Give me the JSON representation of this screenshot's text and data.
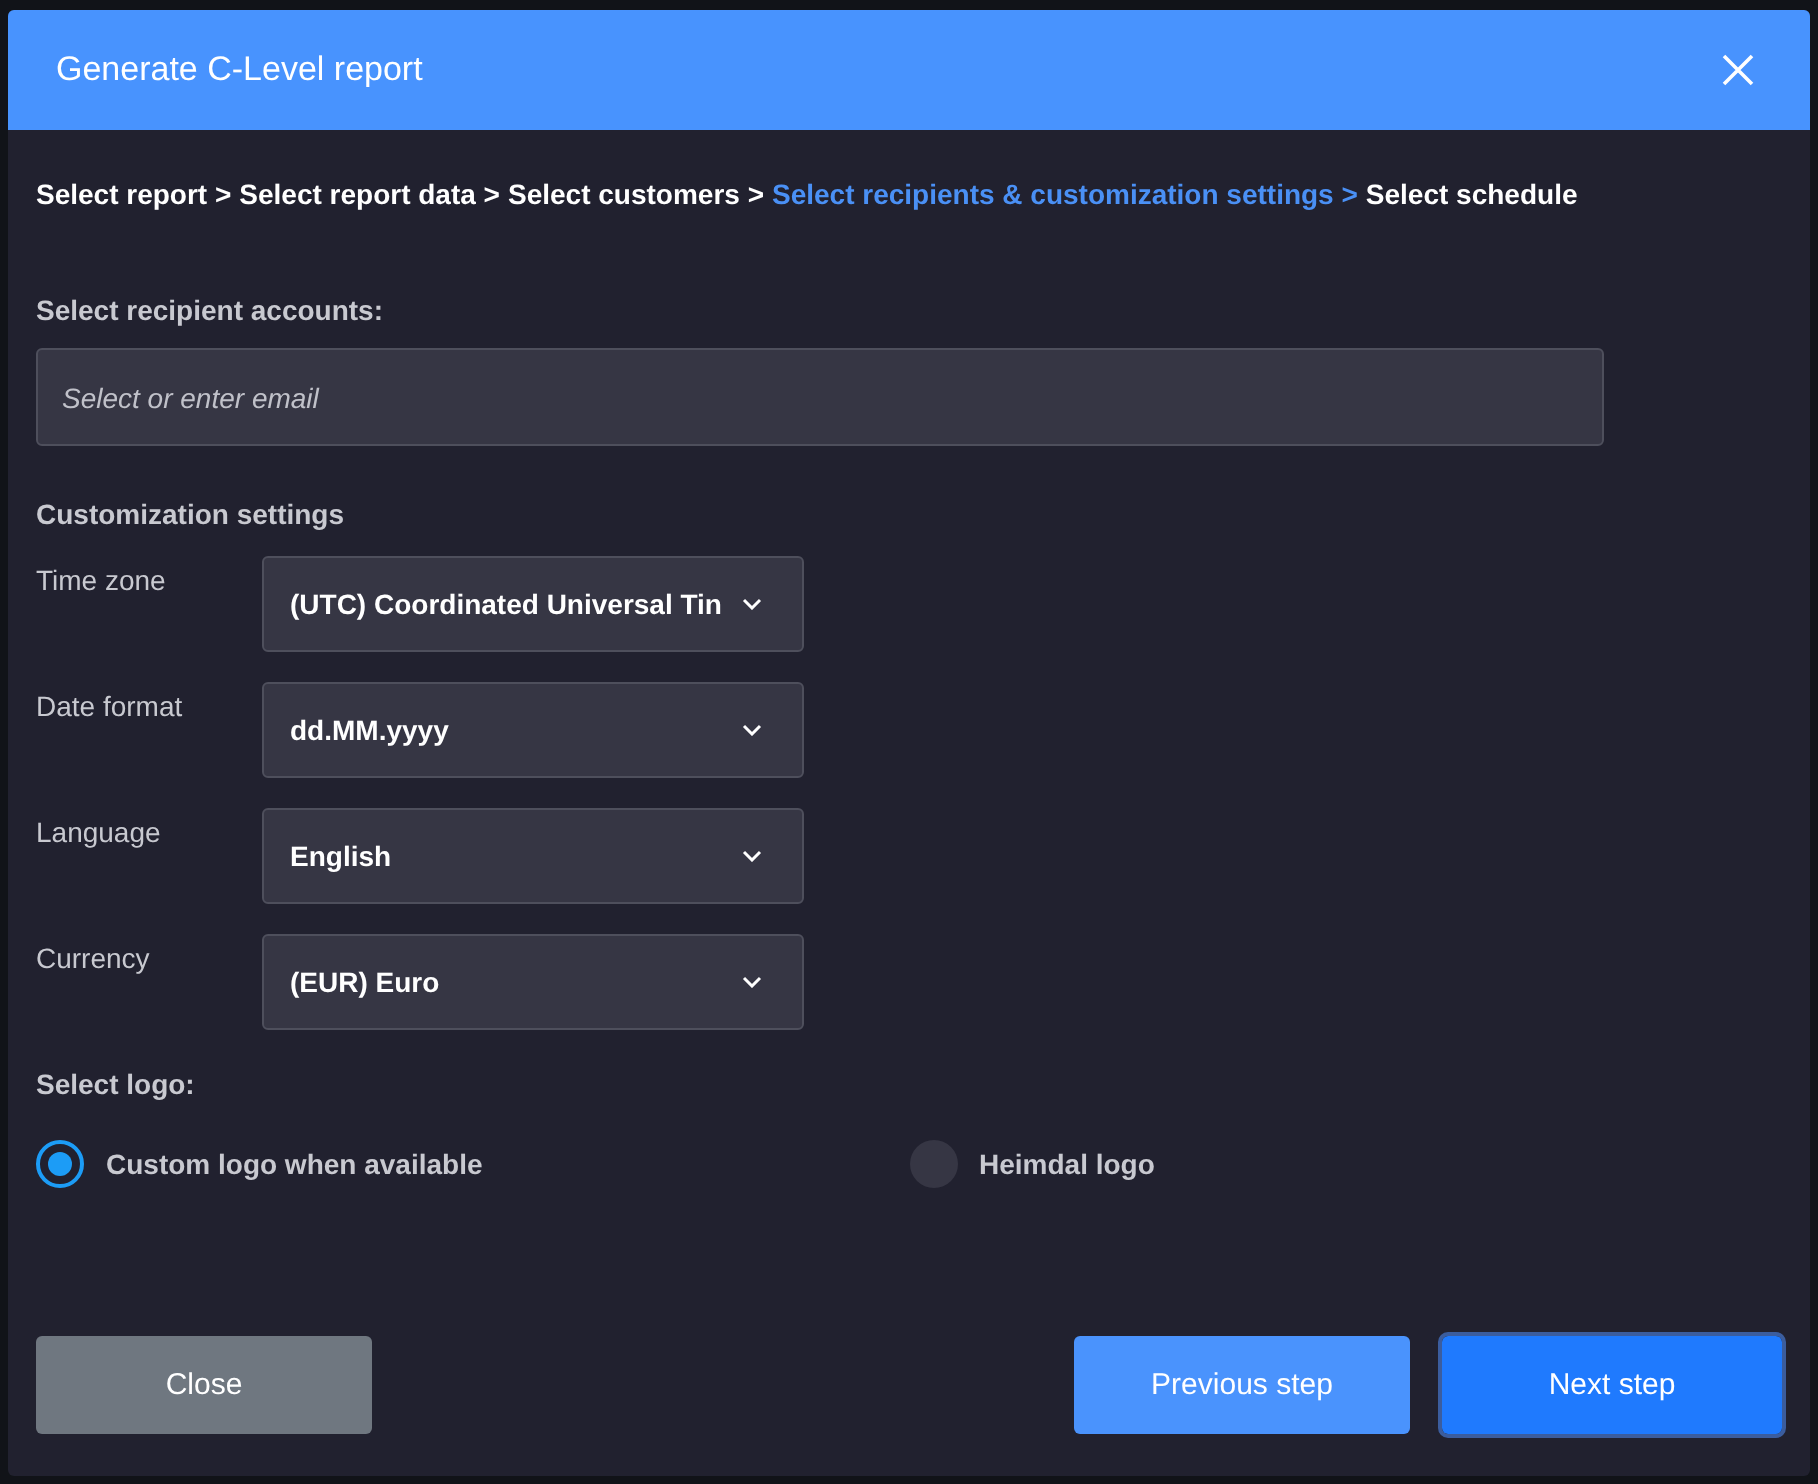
{
  "dialog": {
    "title": "Generate C-Level report"
  },
  "steps": [
    {
      "label": "Select report",
      "separator": ">",
      "selected": false
    },
    {
      "label": "Select report data",
      "separator": ">",
      "selected": false
    },
    {
      "label": "Select customers",
      "separator": ">",
      "selected": false
    },
    {
      "label": "Select recipients & customization settings",
      "separator": ">",
      "selected": true
    },
    {
      "label": "Select schedule",
      "selected": false
    }
  ],
  "recipients": {
    "label": "Select recipient accounts:",
    "placeholder": "Select or enter email"
  },
  "customization": {
    "heading": "Customization settings",
    "settings": [
      {
        "label": "Time zone",
        "value": "(UTC) Coordinated Universal Tin"
      },
      {
        "label": "Date format",
        "value": "dd.MM.yyyy"
      },
      {
        "label": "Language",
        "value": "English"
      },
      {
        "label": "Currency",
        "value": "(EUR) Euro"
      }
    ]
  },
  "logo": {
    "label": "Select logo:",
    "options": [
      {
        "label": "Custom logo when available",
        "selected": true
      },
      {
        "label": "Heimdal logo",
        "selected": false
      }
    ]
  },
  "buttons": [
    {
      "label": "Close",
      "kind": "secondary",
      "focused": false
    },
    {
      "label": "Previous step",
      "kind": "light",
      "focused": false
    },
    {
      "label": "Next step",
      "kind": "primary",
      "focused": true
    }
  ]
}
